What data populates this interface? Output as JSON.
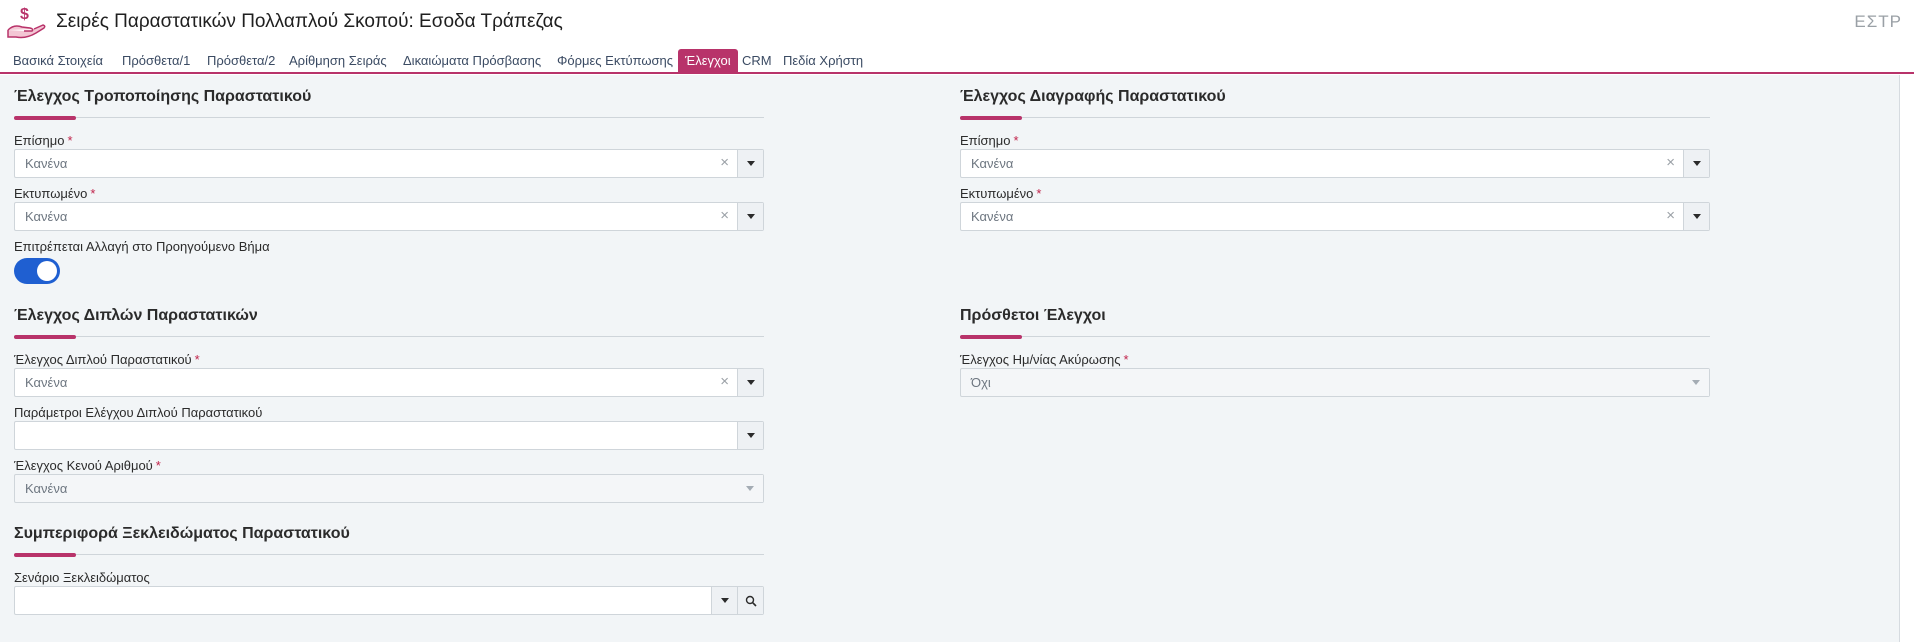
{
  "header": {
    "title": "Σειρές Παραστατικών Πολλαπλού Σκοπού: Εσοδα Τράπεζας",
    "code": "ΕΣΤΡ",
    "icon": "money-hand-icon",
    "accent_color": "#b8336a"
  },
  "tabs": [
    {
      "label": "Βασικά Στοιχεία"
    },
    {
      "label": "Πρόσθετα/1"
    },
    {
      "label": "Πρόσθετα/2"
    },
    {
      "label": "Αρίθμηση Σειράς"
    },
    {
      "label": "Δικαιώματα Πρόσβασης"
    },
    {
      "label": "Φόρμες Εκτύπωσης"
    },
    {
      "label": "Έλεγχοι",
      "active": true
    },
    {
      "label": "CRM"
    },
    {
      "label": "Πεδία Χρήστη"
    }
  ],
  "left": {
    "modify": {
      "title": "Έλεγχος Τροποποίησης Παραστατικού",
      "official_label": "Επίσημο",
      "official_value": "Κανένα",
      "printed_label": "Εκτυπωμένο",
      "printed_value": "Κανένα",
      "allow_back_label": "Επιτρέπεται Αλλαγή στο Προηγούμενο Βήμα",
      "allow_back_on": true
    },
    "duplicates": {
      "title": "Έλεγχος Διπλών Παραστατικών",
      "dup_check_label": "Έλεγχος Διπλού Παραστατικού",
      "dup_check_value": "Κανένα",
      "dup_params_label": "Παράμετροι Ελέγχου Διπλού Παραστατικού",
      "dup_params_value": "",
      "gap_check_label": "Έλεγχος Κενού Αριθμού",
      "gap_check_value": "Κανένα"
    },
    "unlock": {
      "title": "Συμπεριφορά Ξεκλειδώματος Παραστατικού",
      "scenario_label": "Σενάριο Ξεκλειδώματος",
      "scenario_value": ""
    }
  },
  "right": {
    "delete": {
      "title": "Έλεγχος Διαγραφής Παραστατικού",
      "official_label": "Επίσημο",
      "official_value": "Κανένα",
      "printed_label": "Εκτυπωμένο",
      "printed_value": "Κανένα"
    },
    "extra": {
      "title": "Πρόσθετοι Έλεγχοι",
      "cancel_date_label": "Έλεγχος Ημ/νίας Ακύρωσης",
      "cancel_date_value": "Όχι"
    }
  },
  "required_mark": "*",
  "clear_glyph": "×"
}
